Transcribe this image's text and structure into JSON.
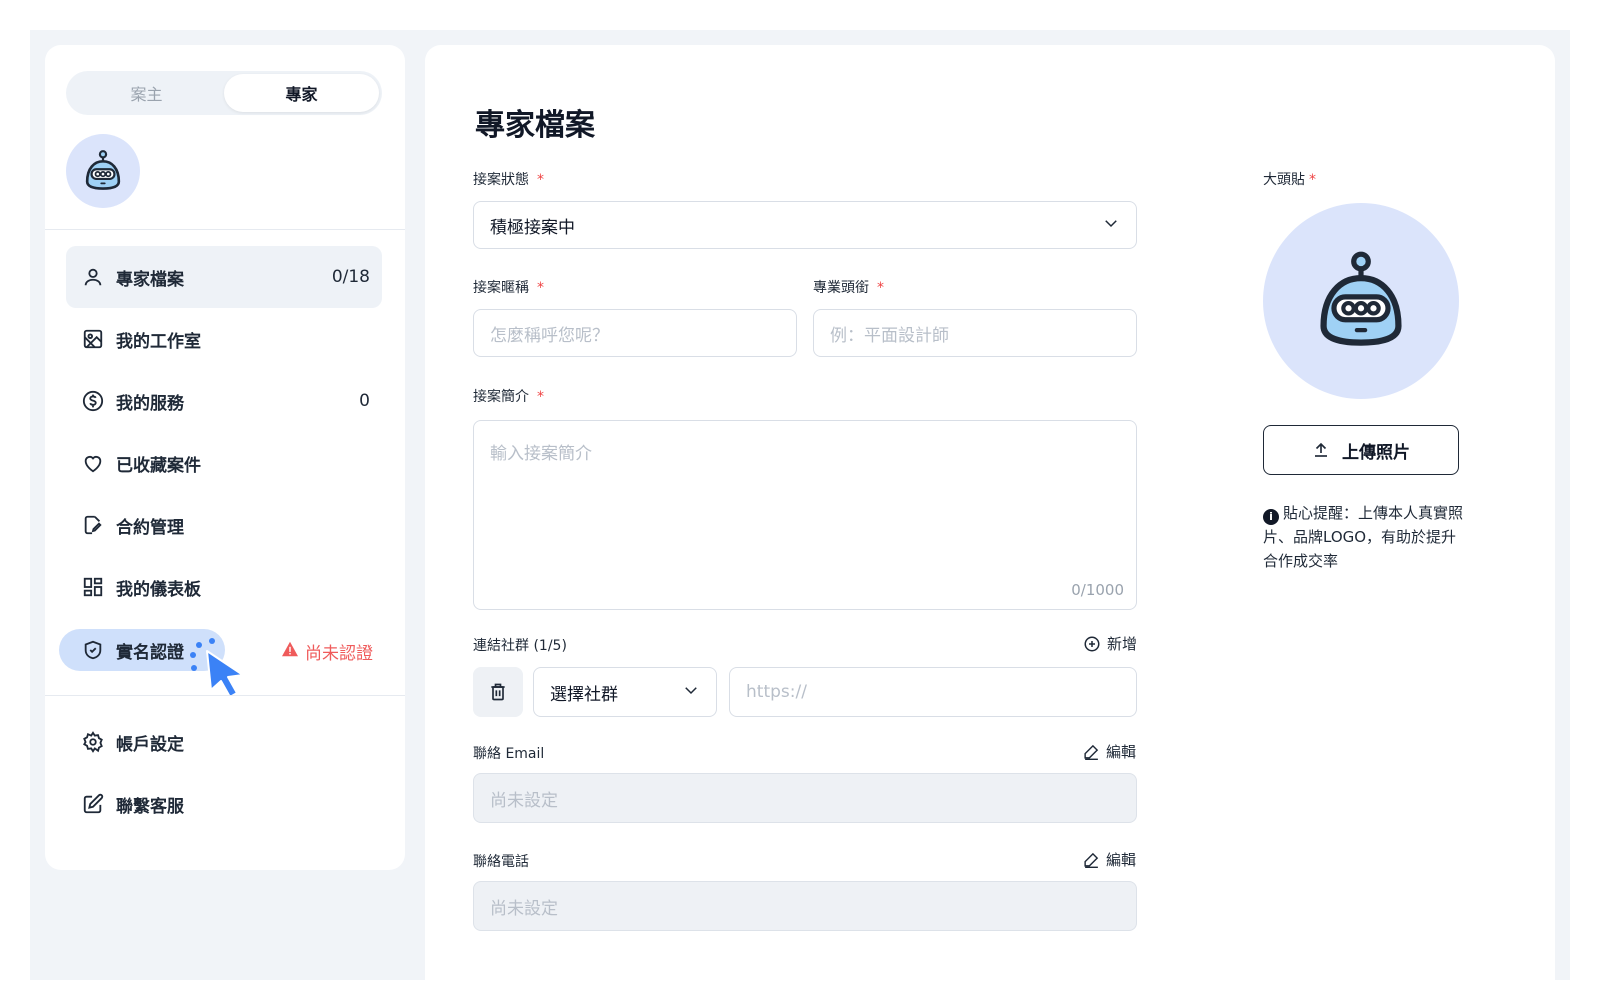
{
  "sidebar": {
    "role_toggle": {
      "client_label": "案主",
      "expert_label": "專家"
    },
    "nav": [
      {
        "label": "專家檔案",
        "count": "0/18",
        "icon": "user-icon"
      },
      {
        "label": "我的工作室",
        "count": "",
        "icon": "gallery-icon"
      },
      {
        "label": "我的服務",
        "count": "0",
        "icon": "dollar-icon"
      },
      {
        "label": "已收藏案件",
        "count": "",
        "icon": "heart-icon"
      },
      {
        "label": "合約管理",
        "count": "",
        "icon": "contract-icon"
      },
      {
        "label": "我的儀表板",
        "count": "",
        "icon": "dashboard-icon"
      },
      {
        "label": "實名認證",
        "count": "",
        "icon": "shield-icon"
      }
    ],
    "verify_status": "尚未認證",
    "bottom_nav": [
      {
        "label": "帳戶設定",
        "icon": "gear-icon"
      },
      {
        "label": "聯繫客服",
        "icon": "edit-icon"
      }
    ]
  },
  "main": {
    "title": "專家檔案",
    "status": {
      "label": "接案狀態",
      "value": "積極接案中"
    },
    "nickname": {
      "label": "接案暱稱",
      "placeholder": "怎麼稱呼您呢？"
    },
    "job_title": {
      "label": "專業頭銜",
      "placeholder": "例：平面設計師"
    },
    "intro": {
      "label": "接案簡介",
      "placeholder": "輸入接案簡介",
      "counter": "0/1000"
    },
    "social": {
      "label": "連結社群 (1/5)",
      "add_label": "新增",
      "select_value": "選擇社群",
      "url_placeholder": "https://"
    },
    "email": {
      "label": "聯絡 Email",
      "edit_label": "編輯",
      "value": "尚未設定"
    },
    "phone": {
      "label": "聯絡電話",
      "edit_label": "編輯",
      "value": "尚未設定"
    },
    "avatar": {
      "label": "大頭貼",
      "upload_label": "上傳照片",
      "tip": "貼心提醒：上傳本人真實照片、品牌LOGO，有助於提升合作成交率"
    }
  },
  "colors": {
    "accent_bg": "#dbe4fb",
    "selected_pill": "#cfe0fb",
    "warning": "#ef5b5b",
    "required": "#ef4444",
    "cursor": "#3b82f6"
  }
}
